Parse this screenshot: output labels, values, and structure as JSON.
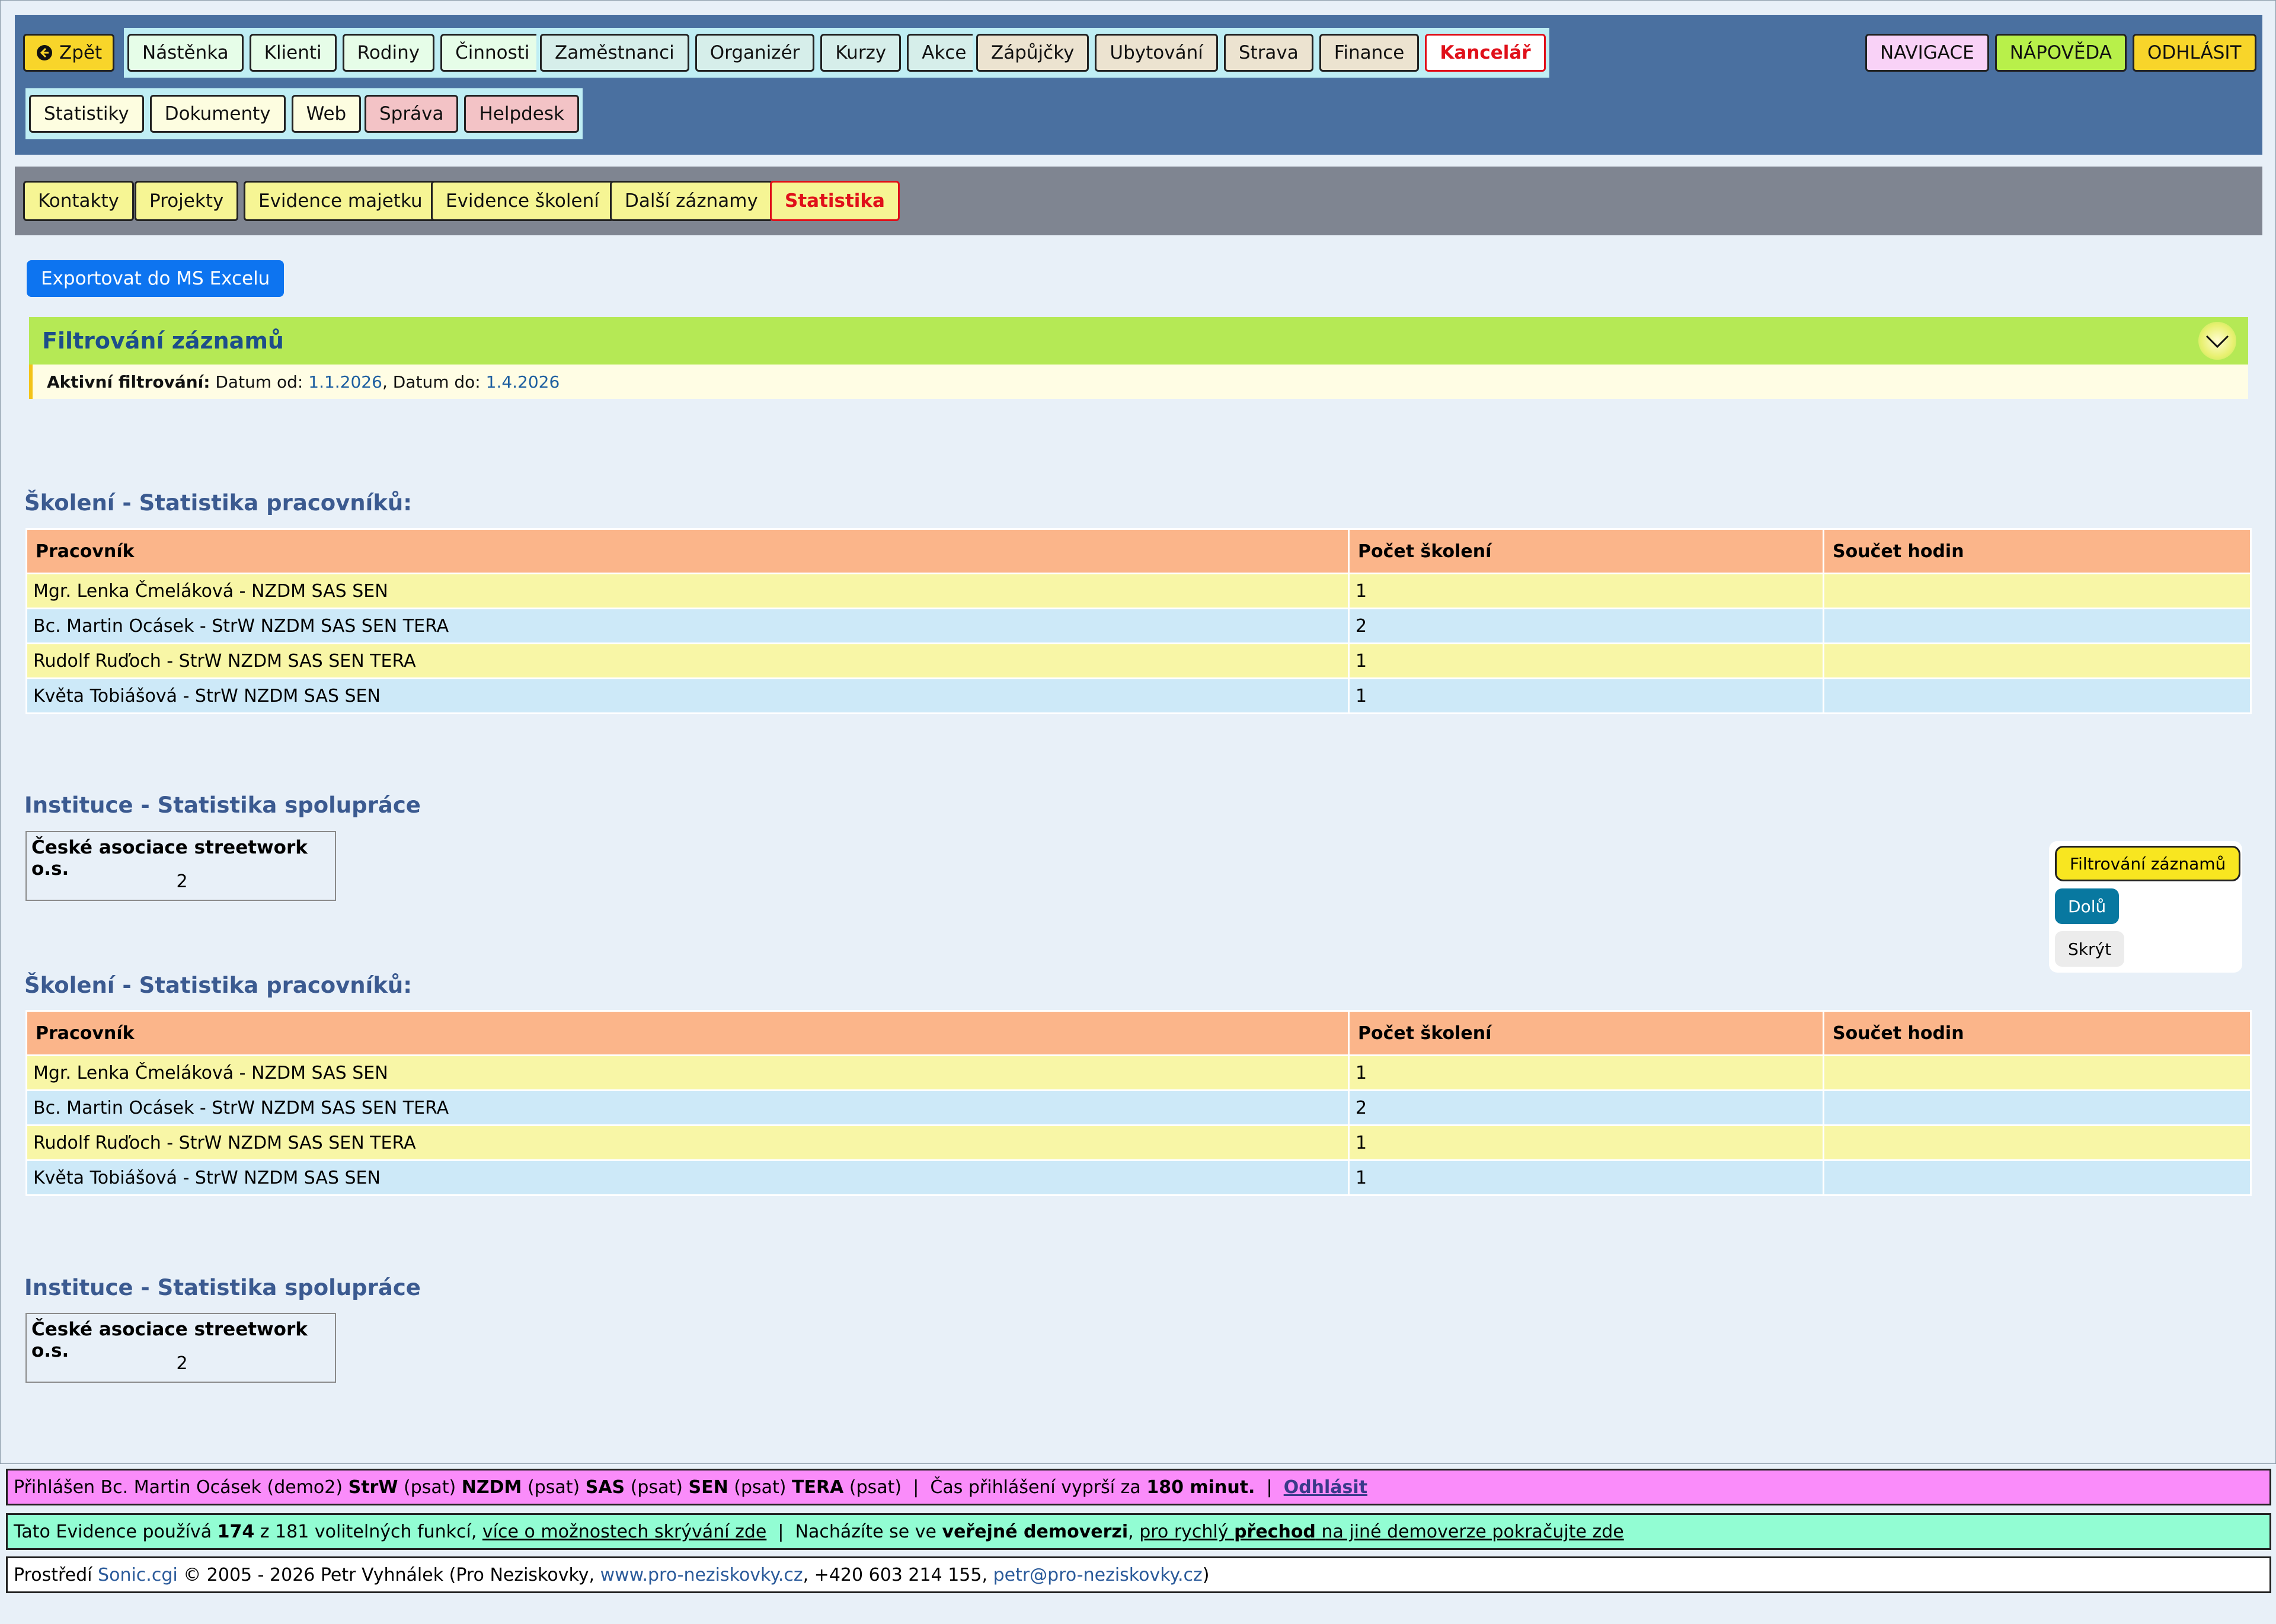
{
  "nav": {
    "back": "Zpět",
    "group1": [
      "Nástěnka",
      "Klienti",
      "Rodiny",
      "Činnosti"
    ],
    "group2": [
      "Zaměstnanci",
      "Organizér",
      "Kurzy",
      "Akce"
    ],
    "group3": [
      "Zápůjčky",
      "Ubytování",
      "Strava",
      "Finance",
      "Kancelář"
    ],
    "right": [
      "NAVIGACE",
      "NÁPOVĚDA",
      "ODHLÁSIT"
    ],
    "group4": [
      "Statistiky",
      "Dokumenty",
      "Web"
    ],
    "group5": [
      "Správa",
      "Helpdesk"
    ]
  },
  "subnav": [
    "Kontakty",
    "Projekty",
    "Evidence majetku",
    "Evidence školení",
    "Další záznamy",
    "Statistika"
  ],
  "export_label": "Exportovat do MS Excelu",
  "filter": {
    "title": "Filtrování záznamů",
    "active_label": "Aktivní filtrování:",
    "from_label": "Datum od:",
    "from_value": "1.1.2026",
    "sep": ",",
    "to_label": "Datum do:",
    "to_value": "1.4.2026"
  },
  "sections": [
    {
      "training_title": "Školení - Statistika pracovníků:",
      "columns": [
        "Pracovník",
        "Počet školení",
        "Součet hodin"
      ],
      "rows": [
        [
          "Mgr. Lenka Čmeláková - NZDM SAS SEN",
          "1",
          ""
        ],
        [
          "Bc. Martin Ocásek - StrW NZDM SAS SEN TERA",
          "2",
          ""
        ],
        [
          "Rudolf Ruďoch - StrW NZDM SAS SEN TERA",
          "1",
          ""
        ],
        [
          "Květa Tobiášová - StrW NZDM SAS SEN",
          "1",
          ""
        ]
      ],
      "inst_title": "Instituce - Statistika spolupráce",
      "inst_name": "České asociace streetwork o.s.",
      "inst_count": "2"
    },
    {
      "training_title": "Školení - Statistika pracovníků:",
      "columns": [
        "Pracovník",
        "Počet školení",
        "Součet hodin"
      ],
      "rows": [
        [
          "Mgr. Lenka Čmeláková - NZDM SAS SEN",
          "1",
          ""
        ],
        [
          "Bc. Martin Ocásek - StrW NZDM SAS SEN TERA",
          "2",
          ""
        ],
        [
          "Rudolf Ruďoch - StrW NZDM SAS SEN TERA",
          "1",
          ""
        ],
        [
          "Květa Tobiášová - StrW NZDM SAS SEN",
          "1",
          ""
        ]
      ],
      "inst_title": "Instituce - Statistika spolupráce",
      "inst_name": "České asociace streetwork o.s.",
      "inst_count": "2"
    }
  ],
  "float_panel": {
    "filter": "Filtrování záznamů",
    "down": "Dolů",
    "hide": "Skrýt"
  },
  "footer": {
    "login_prefix": "Přihlášen Bc. Martin Ocásek (demo2)",
    "roles": [
      {
        "code": "StrW",
        "note": "(psat)"
      },
      {
        "code": "NZDM",
        "note": "(psat)"
      },
      {
        "code": "SAS",
        "note": "(psat)"
      },
      {
        "code": "SEN",
        "note": "(psat)"
      },
      {
        "code": "TERA",
        "note": "(psat)"
      }
    ],
    "sep": "|",
    "expire_prefix": "Čas přihlášení vyprší za",
    "expire_value": "180 minut.",
    "logout": "Odhlásit",
    "features_prefix": "Tato Evidence používá",
    "features_used": "174",
    "features_suffix": "z 181 volitelných funkcí,",
    "features_link": "více o možnostech skrývání zde",
    "demo_prefix": "Nacházíte se ve",
    "demo_bold": "veřejné demoverzi",
    "demo_link1": "pro rychlý",
    "demo_link_bold": "přechod",
    "demo_link2": "na jiné demoverze pokračujte zde",
    "credits_prefix": "Prostředí",
    "credits_app": "Sonic.cgi",
    "credits_mid": "© 2005 - 2026 Petr Vyhnálek (Pro Neziskovky,",
    "credits_web": "www.pro-neziskovky.cz",
    "credits_phone": ", +420 603 214 155,",
    "credits_email": "petr@pro-neziskovky.cz",
    "credits_end": ")"
  },
  "colors": {
    "topnav_bg": "#4a70a0",
    "subnav_bg": "#7f8591",
    "accent_red": "#e0101a",
    "export_blue": "#0d74f0"
  }
}
